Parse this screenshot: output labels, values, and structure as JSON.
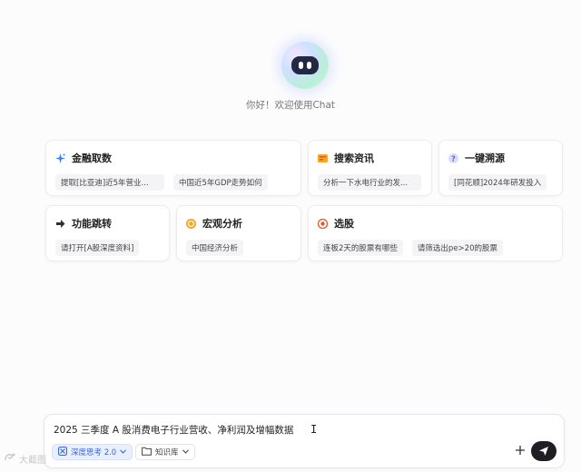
{
  "greeting": "你好！欢迎使用Chat",
  "cards": {
    "finance": {
      "title": "金融取数",
      "chips": [
        "提取[比亚迪]近5年营业...",
        "中国近5年GDP走势如何"
      ]
    },
    "search": {
      "title": "搜索资讯",
      "chips": [
        "分析一下水电行业的发..."
      ]
    },
    "trace": {
      "title": "一键溯源",
      "chips": [
        "[同花顺]2024年研发投入"
      ]
    },
    "jump": {
      "title": "功能跳转",
      "chips": [
        "请打开[A股深度资料]"
      ]
    },
    "macro": {
      "title": "宏观分析",
      "chips": [
        "中国经济分析"
      ]
    },
    "stock": {
      "title": "选股",
      "chips": [
        "连板2天的股票有哪些",
        "请筛选出pe>20的股票"
      ]
    }
  },
  "input": {
    "value": "2025 三季度 A 股消费电子行业营收、净利润及增幅数据",
    "deep_think_label": "深度思考 2.0",
    "knowledge_label": "知识库"
  },
  "watermark": "大截图"
}
